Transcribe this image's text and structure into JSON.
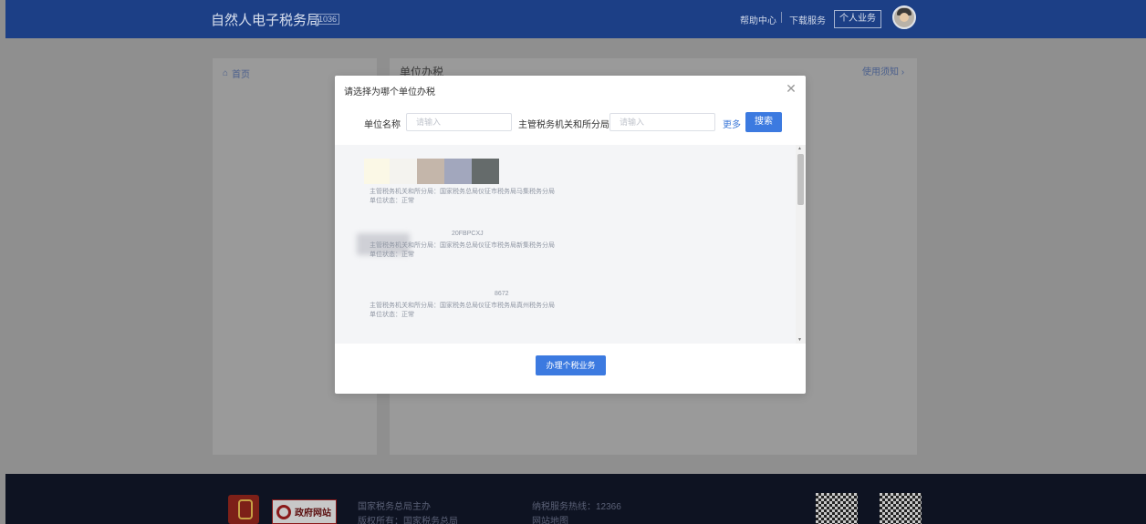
{
  "header": {
    "brand": "自然人电子税务局",
    "brand_sub": "1036",
    "help_center": "帮助中心",
    "download": "下载服务",
    "personal": "个人业务"
  },
  "sidebar": {
    "home": "首页"
  },
  "content": {
    "title": "单位办税",
    "guide_link": "使用须知 ›"
  },
  "modal": {
    "title": "请选择为哪个单位办税",
    "company_name_label": "单位名称",
    "company_name_placeholder": "请输入",
    "tax_office_label": "主管税务机关和所分局",
    "tax_office_placeholder": "请输入",
    "more_link": "更多",
    "search_button": "搜索",
    "submit_button": "办理个税业务",
    "items": [
      {
        "office_line": "主管税务机关和所分局：国家税务总局仪征市税务局马集税务分局",
        "status_line": "单位状态：正常",
        "id_fragment": ""
      },
      {
        "office_line": "主管税务机关和所分局：国家税务总局仪征市税务局新集税务分局",
        "status_line": "单位状态：正常",
        "id_fragment": "20FBPCXJ"
      },
      {
        "office_line": "主管税务机关和所分局：国家税务总局仪征市税务局真州税务分局",
        "status_line": "单位状态：正常",
        "id_fragment": "8672"
      }
    ]
  },
  "footer": {
    "gov_site": "政府网站",
    "host": "国家税务总局主办",
    "copyright": "版权所有：国家税务总局",
    "hotline": "纳税服务热线：12366",
    "sitemap": "网站地图"
  }
}
